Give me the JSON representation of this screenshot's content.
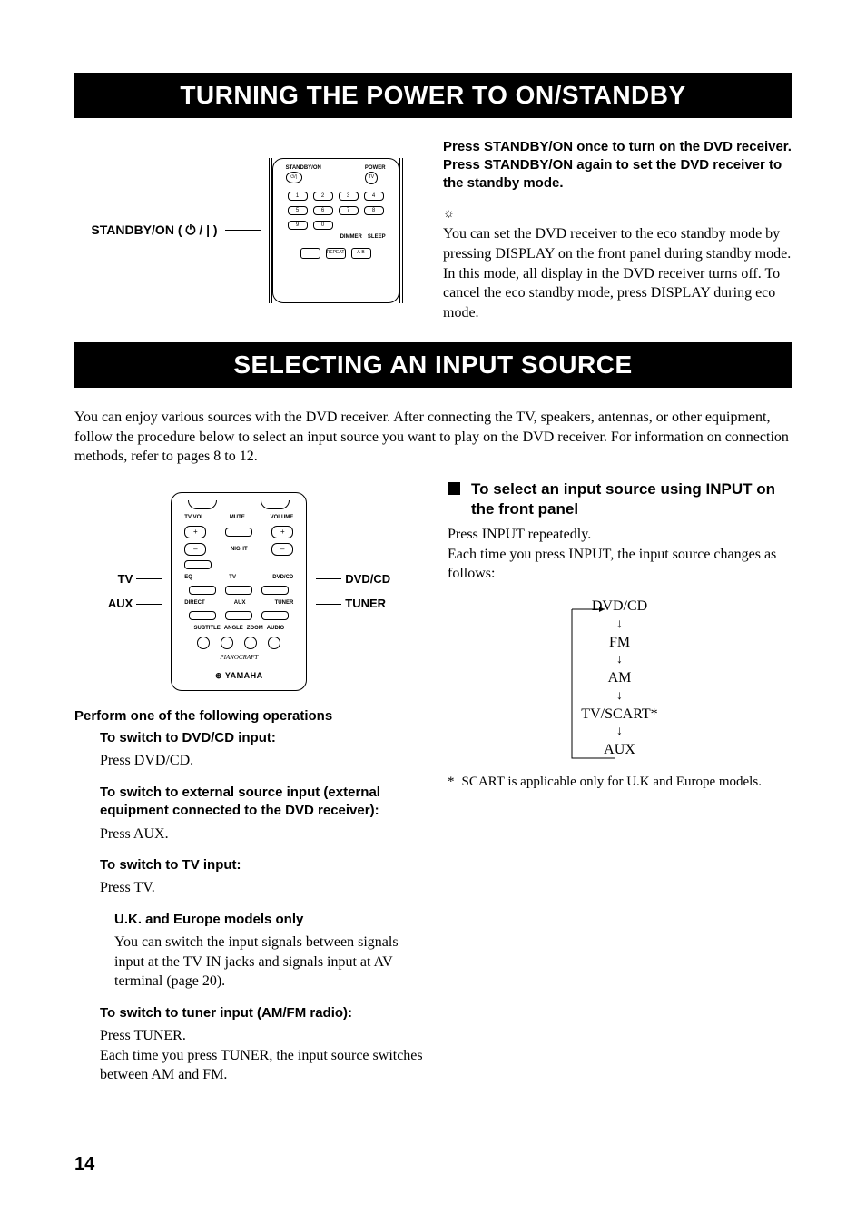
{
  "section1": {
    "title": "TURNING THE POWER TO ON/STANDBY",
    "remote_label": "STANDBY/ON ( ⏻ / | )",
    "remote": {
      "standby_on": "STANDBY/ON",
      "power": "POWER",
      "tv": "TV",
      "nums": [
        "1",
        "2",
        "3",
        "4",
        "5",
        "6",
        "7",
        "8",
        "9",
        "0"
      ],
      "dimmer": "DIMMER",
      "sleep": "SLEEP",
      "plus": "+",
      "repeat": "REPEAT",
      "ab": "A-B"
    },
    "instr1": "Press STANDBY/ON once to turn on the DVD receiver.",
    "instr2": "Press STANDBY/ON again to set the DVD receiver to the standby mode.",
    "tip": "You can set the DVD receiver to the eco standby mode by pressing DISPLAY on the front panel during standby mode. In this mode, all display in the DVD receiver turns off. To cancel the eco standby mode, press DISPLAY during eco mode."
  },
  "section2": {
    "title": "SELECTING AN INPUT SOURCE",
    "intro": "You can enjoy various sources with the DVD receiver. After connecting the TV, speakers, antennas, or other equipment, follow the procedure below to select an input source you want to play on the DVD receiver. For information on connection methods, refer to pages 8 to 12.",
    "left_labels": {
      "tv": "TV",
      "aux": "AUX"
    },
    "right_labels": {
      "dvdcd": "DVD/CD",
      "tuner": "TUNER"
    },
    "remote2": {
      "tvvol": "TV VOL",
      "volume": "VOLUME",
      "mute": "MUTE",
      "night": "NIGHT",
      "eq": "EQ",
      "tv": "TV",
      "dvdcd": "DVD/CD",
      "direct": "DIRECT",
      "aux": "AUX",
      "tuner": "TUNER",
      "subtitle": "SUBTITLE",
      "angle": "ANGLE",
      "zoom": "ZOOM",
      "audio": "AUDIO",
      "pianocraft": "PIANOCRAFT",
      "yamaha": "YAMAHA",
      "plus": "+",
      "minus": "–"
    },
    "perform": "Perform one of the following operations",
    "dvd_h": "To switch to DVD/CD input:",
    "dvd_b": "Press DVD/CD.",
    "ext_h": "To switch to external source input (external equipment connected to the DVD receiver):",
    "ext_b": "Press AUX.",
    "tv_h": "To switch to TV input:",
    "tv_b": "Press TV.",
    "uk_h": "U.K. and Europe models only",
    "uk_b": "You can switch the input signals between signals input at the TV IN jacks and signals input at AV terminal (page 20).",
    "tuner_h": "To switch to tuner input (AM/FM radio):",
    "tuner_b1": "Press TUNER.",
    "tuner_b2": "Each time you press TUNER, the input source switches between AM and FM.",
    "right_h": "To select an input source using INPUT on the front panel",
    "right_p1": "Press INPUT repeatedly.",
    "right_p2": "Each time you press INPUT, the input source changes as follows:",
    "cycle": {
      "a": "DVD/CD",
      "b": "FM",
      "c": "AM",
      "d": "TV/SCART*",
      "e": "AUX"
    },
    "foot_star": "*",
    "foot": "SCART is applicable only for U.K and Europe models."
  },
  "pagenum": "14"
}
